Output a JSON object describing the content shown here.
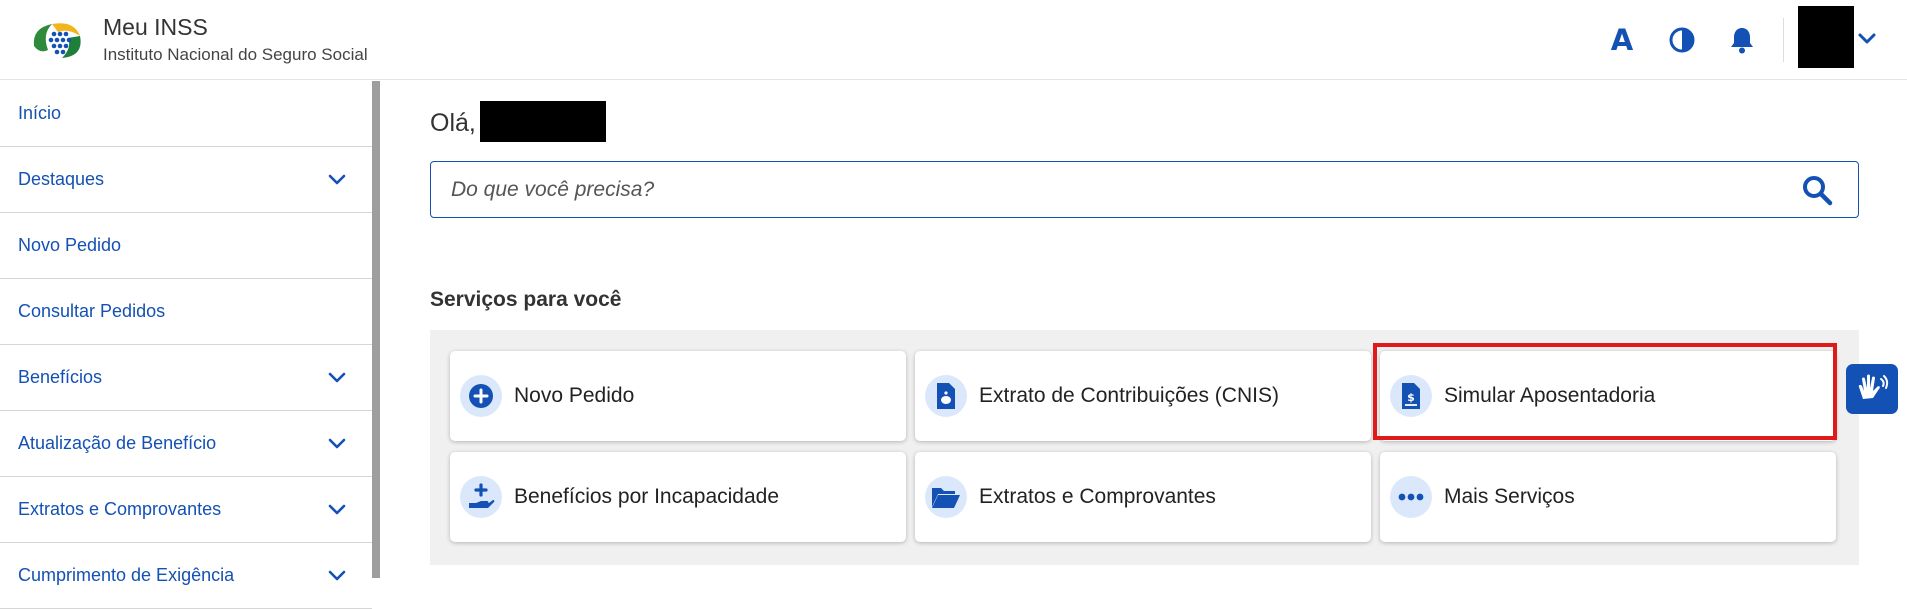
{
  "header": {
    "title": "Meu INSS",
    "subtitle": "Instituto Nacional do Seguro Social",
    "font_label": "A",
    "icons": [
      "font-size-icon",
      "contrast-icon",
      "bell-icon",
      "chevron-down-icon"
    ]
  },
  "sidebar": {
    "items": [
      {
        "label": "Início",
        "expandable": false
      },
      {
        "label": "Destaques",
        "expandable": true
      },
      {
        "label": "Novo Pedido",
        "expandable": false
      },
      {
        "label": "Consultar Pedidos",
        "expandable": false
      },
      {
        "label": "Benefícios",
        "expandable": true
      },
      {
        "label": "Atualização de Benefício",
        "expandable": true
      },
      {
        "label": "Extratos e Comprovantes",
        "expandable": true
      },
      {
        "label": "Cumprimento de Exigência",
        "expandable": true
      }
    ]
  },
  "main": {
    "greeting": "Olá,",
    "search": {
      "placeholder": "Do que você precisa?"
    },
    "section_title": "Serviços para você",
    "services": [
      {
        "label": "Novo Pedido",
        "icon": "plus-circle-icon"
      },
      {
        "label": "Extrato de Contribuições (CNIS)",
        "icon": "document-piggy-icon"
      },
      {
        "label": "Simular Aposentadoria",
        "icon": "document-dollar-icon"
      },
      {
        "label": "Benefícios por Incapacidade",
        "icon": "hand-plus-icon"
      },
      {
        "label": "Extratos e Comprovantes",
        "icon": "folder-open-icon"
      },
      {
        "label": "Mais Serviços",
        "icon": "ellipsis-icon"
      }
    ]
  },
  "colors": {
    "primary": "#1351b4",
    "highlight": "#e01a1a",
    "icon_bg": "#dbe8fb"
  }
}
